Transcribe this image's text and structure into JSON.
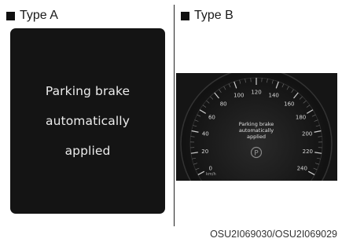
{
  "type_a": {
    "label": "Type A",
    "message_lines": [
      "Parking brake",
      "automatically",
      "applied"
    ]
  },
  "type_b": {
    "label": "Type B",
    "message_lines": [
      "Parking brake",
      "automatically",
      "applied"
    ],
    "speed_ticks": [
      "0",
      "20",
      "40",
      "60",
      "80",
      "100",
      "120",
      "140",
      "160",
      "180",
      "200",
      "220",
      "240"
    ],
    "unit": "km/h",
    "indicator": "P"
  },
  "caption": "OSU2I069030/OSU2I069029",
  "colors": {
    "screen_bg": "#141414",
    "cluster_bg": "#1a1a1a",
    "text": "#ececec",
    "accent_red": "#c33"
  }
}
